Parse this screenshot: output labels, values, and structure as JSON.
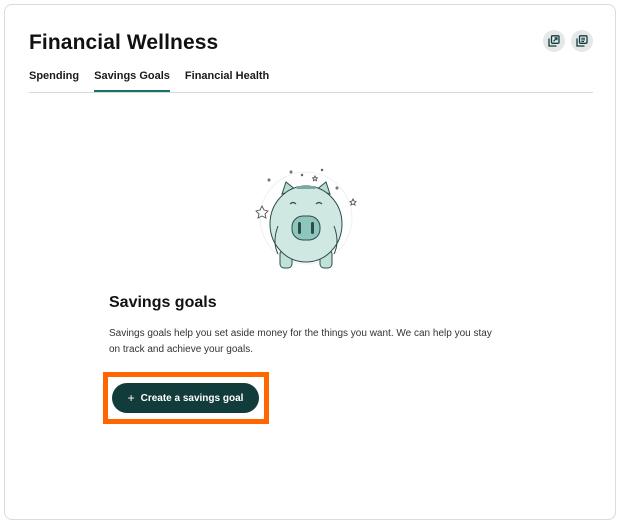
{
  "header": {
    "title": "Financial Wellness",
    "actions": [
      {
        "icon": "open-in-new-window-icon"
      },
      {
        "icon": "copy-icon"
      }
    ]
  },
  "tabs": [
    {
      "label": "Spending",
      "active": false
    },
    {
      "label": "Savings Goals",
      "active": true
    },
    {
      "label": "Financial Health",
      "active": false
    }
  ],
  "empty_state": {
    "illustration": "piggy-bank-illustration",
    "title": "Savings goals",
    "description": "Savings goals help you set aside money for the things you want. We can help you stay on track and achieve your goals.",
    "cta": {
      "icon": "+",
      "label": "Create a savings goal"
    }
  },
  "colors": {
    "primary_button": "#123b3b",
    "active_tab_underline": "#17706a",
    "highlight": "#ff6600",
    "piggy_fill": "#cfe9e2"
  }
}
